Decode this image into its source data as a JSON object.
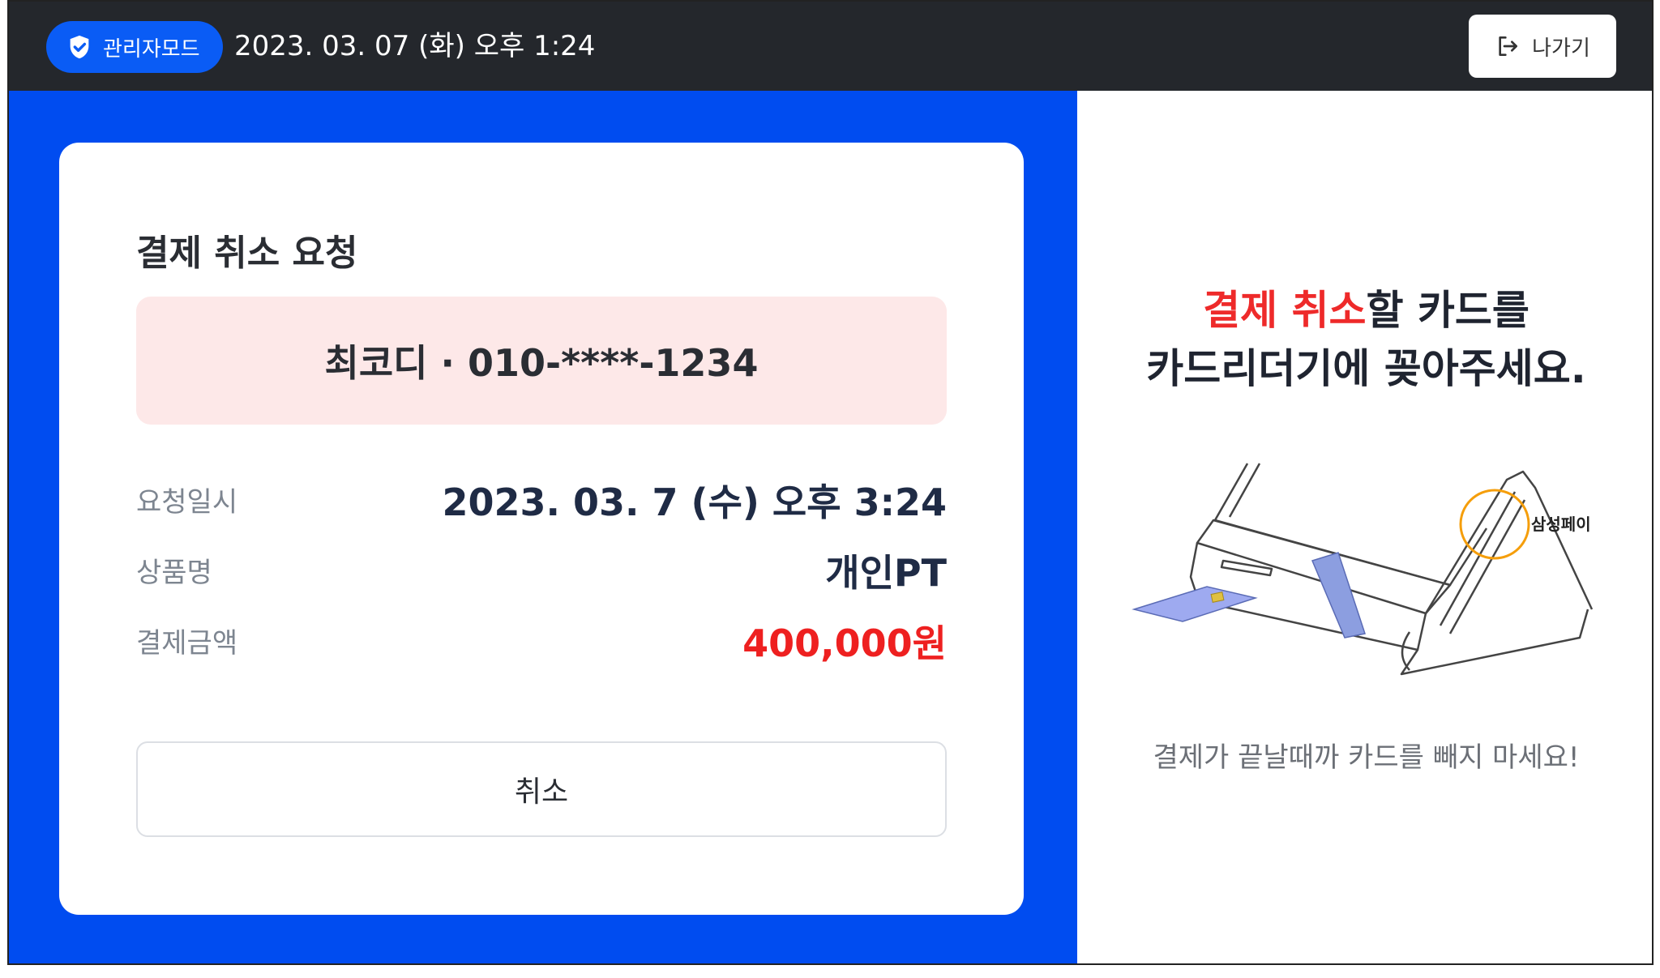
{
  "header": {
    "mode_label": "관리자모드",
    "datetime": "2023. 03. 07 (화) 오후 1:24",
    "exit_label": "나가기"
  },
  "card": {
    "title": "결제 취소 요청",
    "customer": "최코디 · 010-****-1234",
    "rows": [
      {
        "label": "요청일시",
        "value": "2023. 03. 7 (수) 오후 3:24"
      },
      {
        "label": "상품명",
        "value": "개인PT"
      },
      {
        "label": "결제금액",
        "value": "400,000원"
      }
    ],
    "cancel_label": "취소"
  },
  "instruction": {
    "highlight": "결제 취소",
    "line1_rest": "할 카드를",
    "line2": "카드리더기에 꽂아주세요."
  },
  "device": {
    "samsung_pay_label": "삼성페이"
  },
  "warning": "결제가 끝날때까 카드를 빼지 마세요!",
  "colors": {
    "primary": "#004cf0",
    "topbar": "#24272c",
    "highlight_red": "#ee2a2a",
    "customer_bg": "#fde8e8"
  }
}
